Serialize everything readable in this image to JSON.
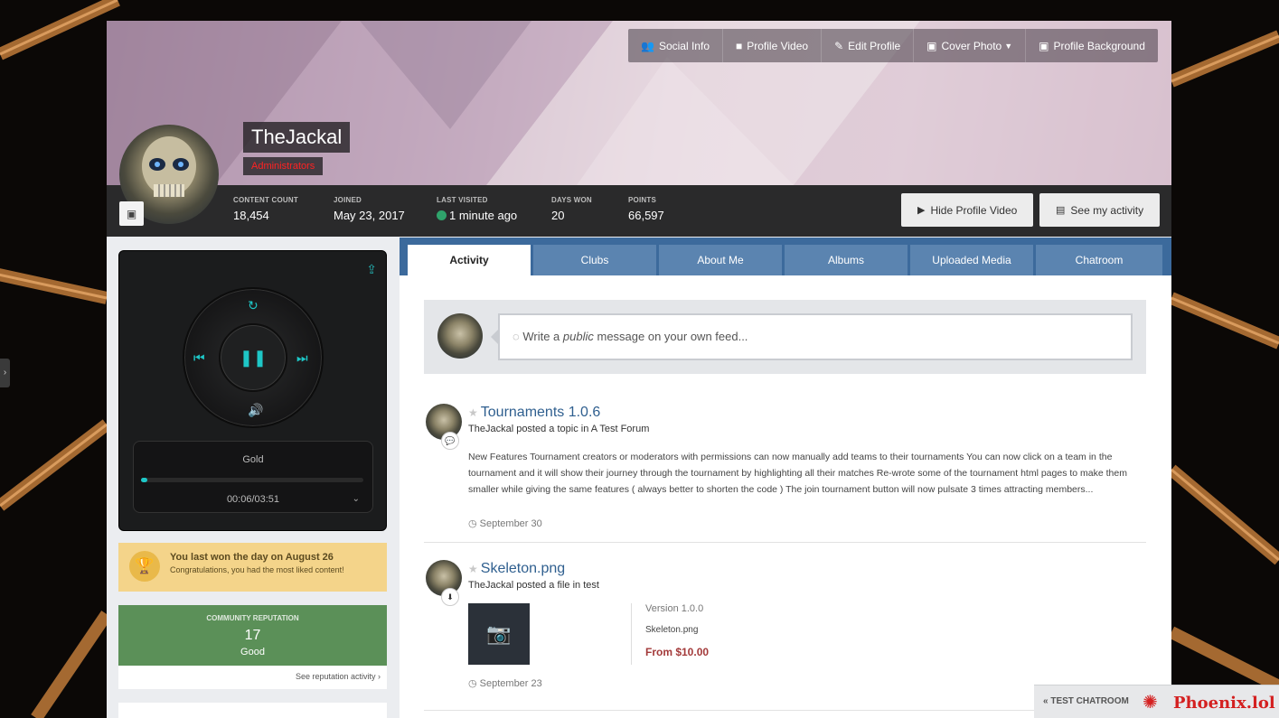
{
  "cover": {
    "buttons": [
      {
        "label": "Social Info",
        "icon": "users-icon"
      },
      {
        "label": "Profile Video",
        "icon": "video-icon"
      },
      {
        "label": "Edit Profile",
        "icon": "pencil-icon"
      },
      {
        "label": "Cover Photo",
        "icon": "image-icon"
      },
      {
        "label": "Profile Background",
        "icon": "image-icon"
      }
    ]
  },
  "profile": {
    "name": "TheJackal",
    "group": "Administrators",
    "group_color": "#ff2222"
  },
  "stats": [
    {
      "label": "CONTENT COUNT",
      "value": "18,454"
    },
    {
      "label": "JOINED",
      "value": "May 23, 2017"
    },
    {
      "label": "LAST VISITED",
      "value": "1 minute ago"
    },
    {
      "label": "DAYS WON",
      "value": "20"
    },
    {
      "label": "POINTS",
      "value": "66,597"
    }
  ],
  "stat_buttons": {
    "hide_video": "Hide Profile Video",
    "see_activity": "See my activity"
  },
  "player": {
    "track": "Gold",
    "time": "00:06/03:51",
    "progress": 0.03,
    "accent": "#1ec7c7"
  },
  "won": {
    "title": "You last won the day on August 26",
    "subtitle": "Congratulations, you had the most liked content!"
  },
  "reputation": {
    "label": "COMMUNITY REPUTATION",
    "value": "17",
    "word": "Good",
    "link": "See reputation activity ›"
  },
  "tabs": [
    "Activity",
    "Clubs",
    "About Me",
    "Albums",
    "Uploaded Media",
    "Chatroom"
  ],
  "composer": {
    "prefix": "Write a ",
    "em": "public",
    "suffix": " message on your own feed..."
  },
  "entries": [
    {
      "title": "Tournaments 1.0.6",
      "meta_user": "TheJackal",
      "meta_action": " posted a topic in ",
      "meta_target": "A Test Forum",
      "body": "New Features Tournament creators or moderators with permissions can now manually add teams to their tournaments You can now click on a team in the tournament and it will show their journey through the tournament by highlighting all their matches Re-wrote some of the tournament html pages to make them smaller while giving the same features ( always better to shorten the code ) The join tournament button will now pulsate 3 times attracting members...",
      "date": "September 30"
    },
    {
      "title": "Skeleton.png",
      "meta_user": "TheJackal",
      "meta_action": " posted a file in ",
      "meta_target": "test",
      "version": "Version 1.0.0",
      "filename": "Skeleton.png",
      "price": "From $10.00",
      "date": "September 23"
    }
  ],
  "chatbar": {
    "label": "TEST CHATROOM",
    "logo": "Phoenix.lol"
  }
}
